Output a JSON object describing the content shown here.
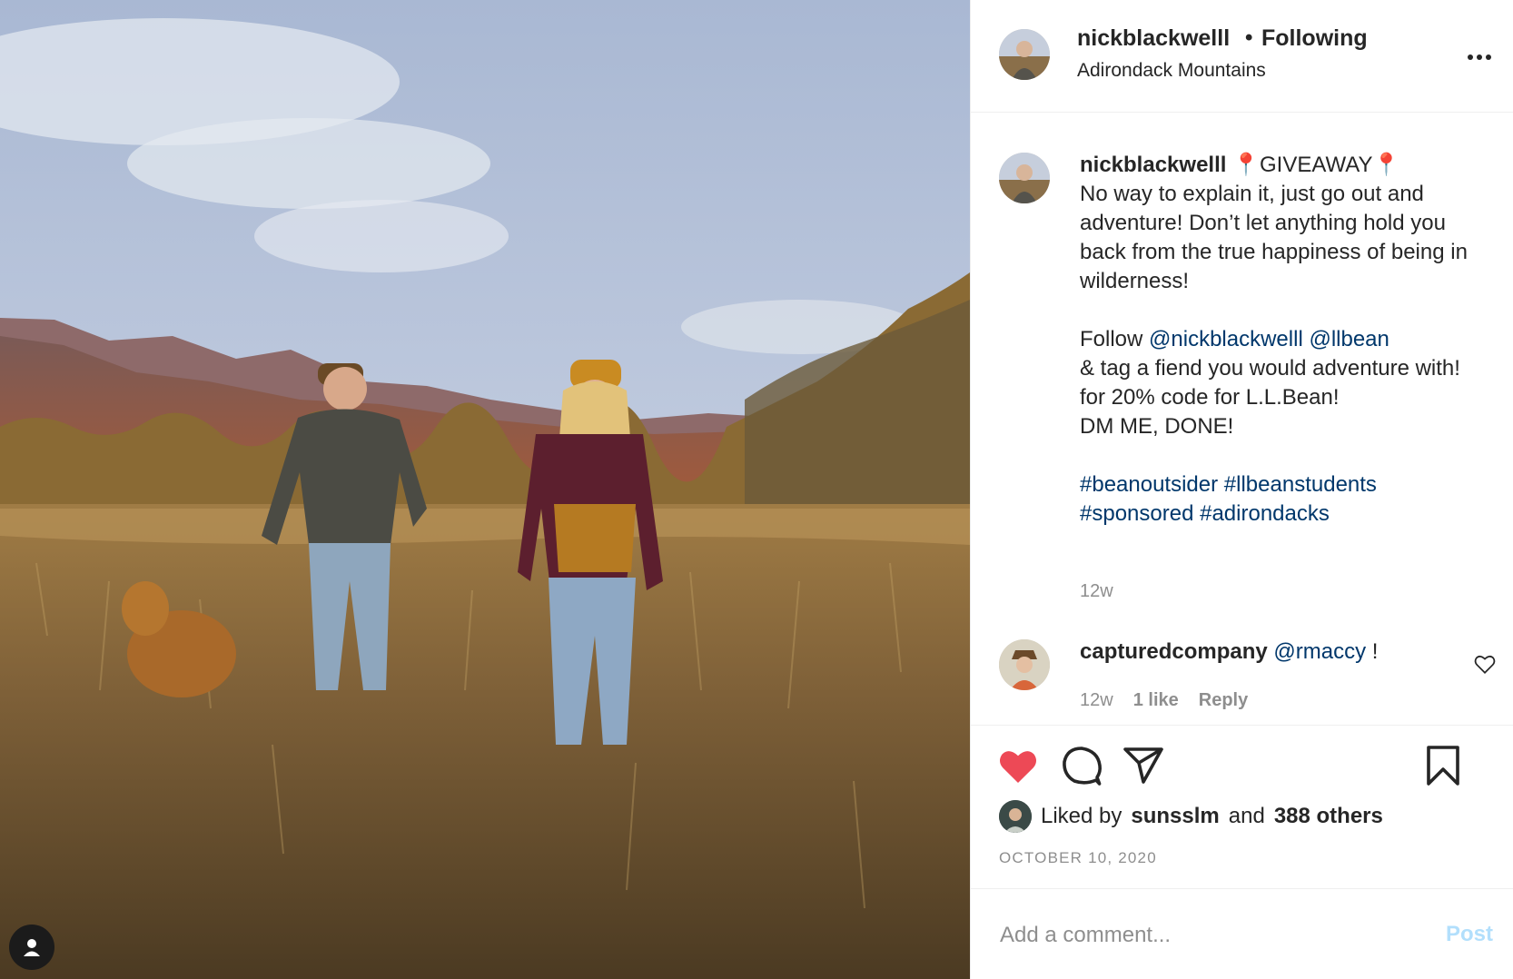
{
  "colors": {
    "link": "#00376b",
    "like_red": "#ed4956",
    "muted": "#8e8e8e",
    "post_disabled": "#b2dffc"
  },
  "header": {
    "username": "nickblackwelll",
    "separator": "•",
    "follow_label": "Following",
    "location": "Adirondack Mountains",
    "more_icon": "more-horizontal-icon"
  },
  "caption": {
    "username": "nickblackwelll",
    "pin_emoji": "📍",
    "giveaway": "GIVEAWAY",
    "line1": "No way to explain it, just go out and adventure! Don’t let anything hold you back from the true happiness of being in wilderness!",
    "follow_prefix": "Follow",
    "mention1": "@nickblackwelll",
    "mention2": "@llbean",
    "line2": "& tag a fiend you would adventure with!",
    "line3": "for 20% code for L.L.Bean!",
    "line4": "DM ME, DONE!",
    "tag1": "#beanoutsider",
    "tag2": "#llbeanstudents",
    "tag3": "#sponsored",
    "tag4": "#adirondacks",
    "time": "12w"
  },
  "comment": {
    "username": "capturedcompany",
    "mention": "@rmaccy",
    "text": "!",
    "time": "12w",
    "likes": "1 like",
    "reply": "Reply"
  },
  "actions": {
    "icons": [
      "heart-filled-icon",
      "comment-icon",
      "share-icon",
      "bookmark-icon"
    ]
  },
  "likes": {
    "prefix": "Liked by",
    "user": "sunsslm",
    "and": "and",
    "others": "388 others"
  },
  "date": "OCTOBER 10, 2020",
  "add_comment": {
    "placeholder": "Add a comment...",
    "post_label": "Post"
  }
}
